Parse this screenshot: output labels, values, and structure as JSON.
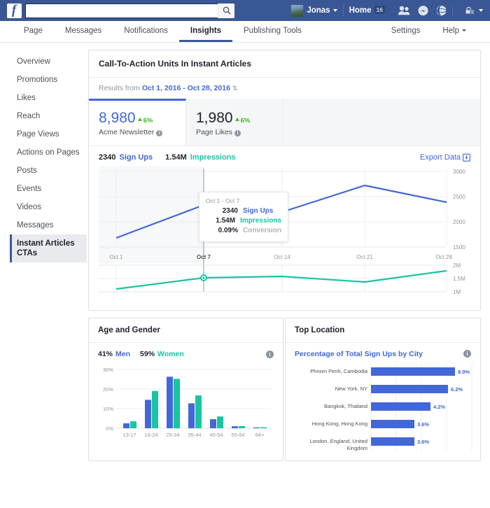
{
  "topbar": {
    "logo": "f",
    "search_value": "",
    "search_placeholder": "",
    "search_icon": "search-icon",
    "user_name": "Jonas",
    "home_label": "Home",
    "home_badge": "16",
    "icons": [
      "friend-requests-icon",
      "messenger-icon",
      "globe-notifications-icon",
      "privacy-lock-icon"
    ]
  },
  "subnav": {
    "items": [
      {
        "label": "Page",
        "active": false
      },
      {
        "label": "Messages",
        "active": false
      },
      {
        "label": "Notifications",
        "active": false
      },
      {
        "label": "Insights",
        "active": true
      },
      {
        "label": "Publishing Tools",
        "active": false
      }
    ],
    "right": [
      {
        "label": "Settings"
      },
      {
        "label": "Help"
      }
    ]
  },
  "sidebar": {
    "items": [
      {
        "label": "Overview",
        "active": false
      },
      {
        "label": "Promotions",
        "active": false
      },
      {
        "label": "Likes",
        "active": false
      },
      {
        "label": "Reach",
        "active": false
      },
      {
        "label": "Page Views",
        "active": false
      },
      {
        "label": "Actions on Pages",
        "active": false
      },
      {
        "label": "Posts",
        "active": false
      },
      {
        "label": "Events",
        "active": false
      },
      {
        "label": "Videos",
        "active": false
      },
      {
        "label": "Messages",
        "active": false
      },
      {
        "label": "Instant Articles CTAs",
        "active": true
      }
    ]
  },
  "main_card": {
    "title": "Call-To-Action Units In Instant Articles",
    "results_prefix": "Results from",
    "date_range": "Oct 1, 2016 - Oct 28, 2016",
    "range_caret": "⇅",
    "stats": [
      {
        "value": "8,980",
        "delta": "6%",
        "label": "Acme Newsletter",
        "active": true
      },
      {
        "value": "1,980",
        "delta": "6%",
        "label": "Page Likes",
        "active": false
      }
    ],
    "legend": [
      {
        "value": "2340",
        "name": "Sign Ups",
        "color": "#4267d8"
      },
      {
        "value": "1.54M",
        "name": "Impressions",
        "color": "#18c5a0"
      }
    ],
    "export_label": "Export Data",
    "export_icon": "download-icon",
    "tooltip": {
      "date": "Oct 1 - Oct 7",
      "rows": [
        {
          "value": "2340",
          "key": "Sign Ups",
          "color": "#4267d8"
        },
        {
          "value": "1.54M",
          "key": "Impressions",
          "color": "#18c5a0"
        },
        {
          "value": "0.09%",
          "key": "Conversion",
          "color": "#b0b3b8"
        }
      ]
    }
  },
  "age_card": {
    "title": "Age and Gender",
    "legend": [
      {
        "pct": "41%",
        "name": "Men",
        "color": "#4267d8"
      },
      {
        "pct": "59%",
        "name": "Women",
        "color": "#18c5a0"
      }
    ],
    "info_icon": "info-icon"
  },
  "location_card": {
    "title": "Top Location",
    "subtitle": "Percentage of Total Sign Ups by City",
    "info_icon": "info-icon"
  },
  "chart_data": [
    {
      "type": "line",
      "name": "Sign Ups",
      "title": "",
      "x": [
        "Oct 1",
        "Oct 7",
        "Oct 14",
        "Oct 21",
        "Oct 28"
      ],
      "values": [
        1680,
        2340,
        2200,
        2720,
        2380
      ],
      "ylim": [
        1500,
        3000
      ],
      "yticks": [
        1500,
        2000,
        2500,
        3000
      ],
      "ytick_labels": [
        "1500",
        "2000",
        "2500",
        "3000"
      ],
      "xlabel": "",
      "ylabel": "",
      "color": "#4267d8",
      "grid": true,
      "legend_position": "top-left",
      "highlight_x": "Oct 7"
    },
    {
      "type": "line",
      "name": "Impressions",
      "title": "",
      "x": [
        "Oct 1",
        "Oct 7",
        "Oct 14",
        "Oct 21",
        "Oct 28"
      ],
      "values": [
        1100000,
        1540000,
        1600000,
        1380000,
        1780000
      ],
      "ylim": [
        1000000,
        2000000
      ],
      "yticks": [
        1000000,
        1500000,
        2000000
      ],
      "ytick_labels": [
        "1M",
        "1.5M",
        "2M"
      ],
      "xlabel": "",
      "ylabel": "",
      "color": "#18c5a0",
      "grid": true,
      "legend_position": "top-left",
      "highlight_x": "Oct 7"
    },
    {
      "type": "bar",
      "title": "Age and Gender",
      "categories": [
        "13-17",
        "18-24",
        "25-34",
        "35-44",
        "45-54",
        "55-64",
        "64+"
      ],
      "series": [
        {
          "name": "Men",
          "color": "#4267d8",
          "values": [
            2.5,
            14.5,
            26.3,
            12.7,
            4.6,
            1.0,
            0.4
          ]
        },
        {
          "name": "Women",
          "color": "#18c5a0",
          "values": [
            3.5,
            19.0,
            25.2,
            16.7,
            6.0,
            1.1,
            0.5
          ]
        }
      ],
      "ylim": [
        0,
        30
      ],
      "yticks": [
        0,
        10,
        20,
        30
      ],
      "ytick_labels": [
        "0%",
        "10%",
        "20%",
        "30%"
      ],
      "xlabel": "",
      "ylabel": "",
      "grid": true
    },
    {
      "type": "bar",
      "orientation": "horizontal",
      "title": "Percentage of Total Sign Ups by City",
      "categories": [
        "Phnom  Penh, Cambodia",
        "New York, NY",
        "Bangkok, Thailand",
        "Hong Kong, Hong Kong",
        "London, England, United Kingdom"
      ],
      "values": [
        8.9,
        6.2,
        4.2,
        3.6,
        3.6
      ],
      "value_labels": [
        "8.9%",
        "6.2%",
        "4.2%",
        "3.6%",
        "3.6%"
      ],
      "xlim": [
        0,
        10
      ],
      "color": "#4267d8",
      "grid": true
    }
  ]
}
